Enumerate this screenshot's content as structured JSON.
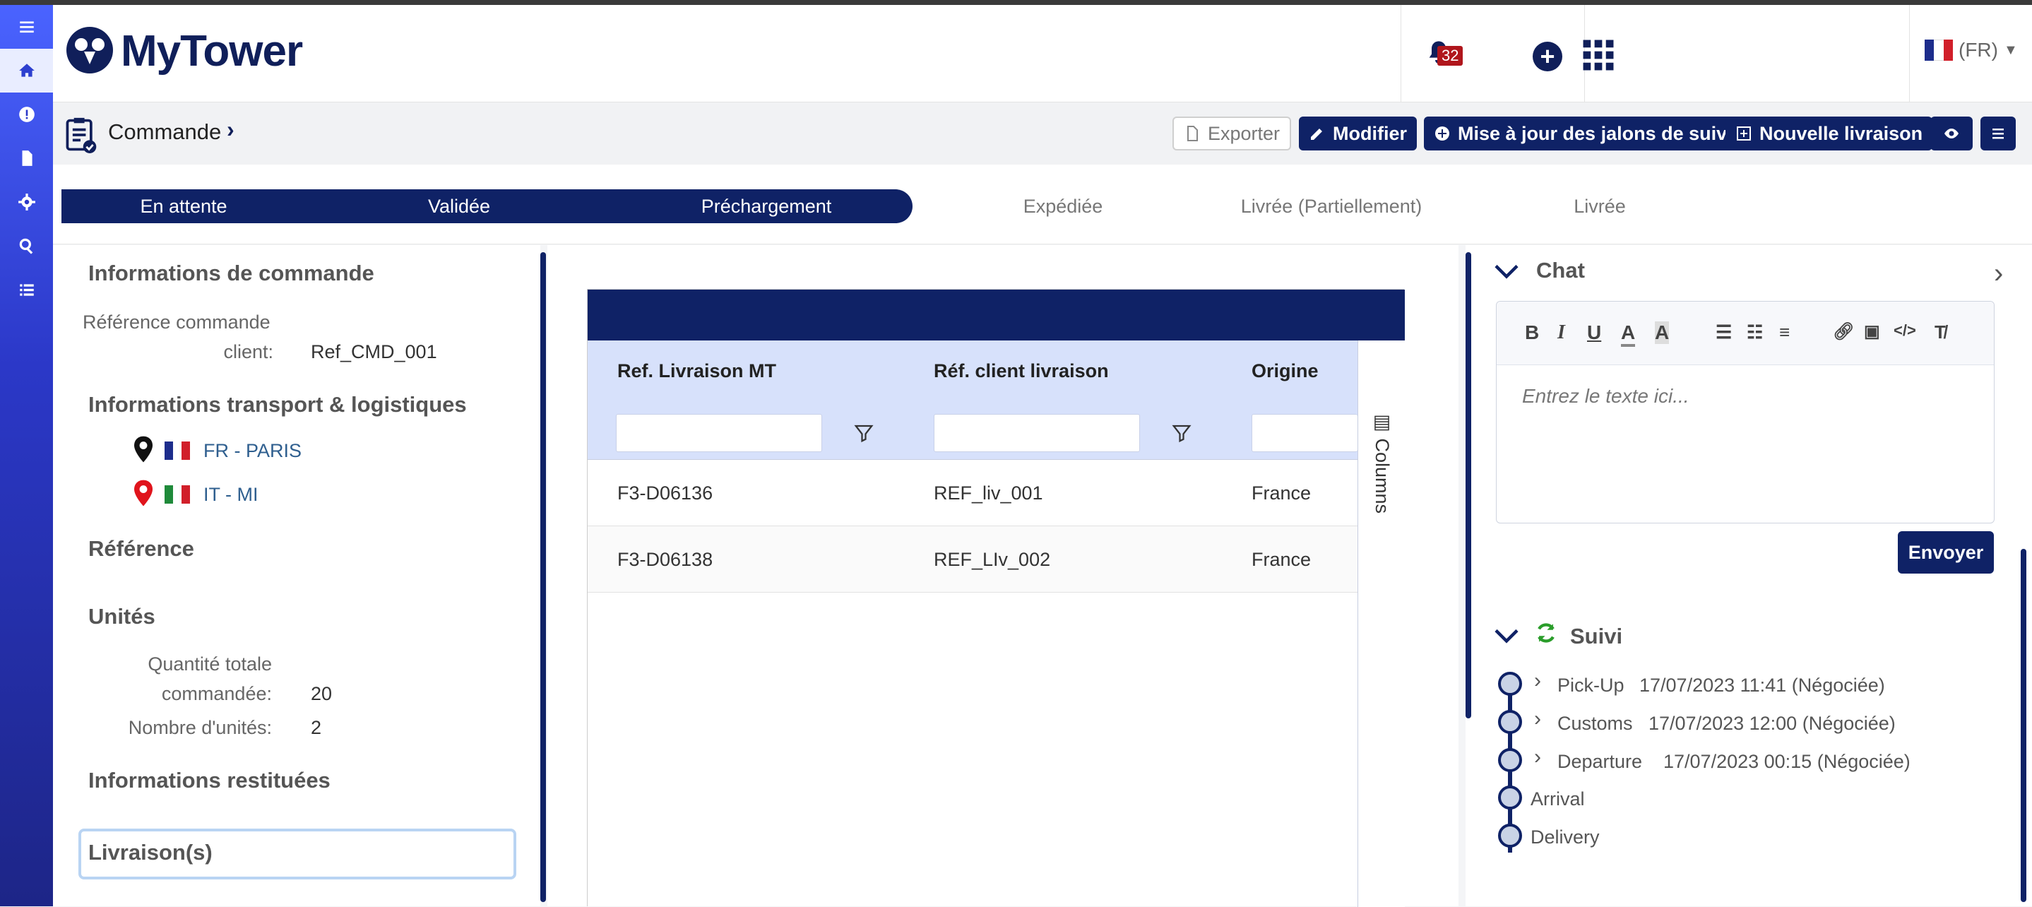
{
  "app": {
    "name": "MyTower",
    "language": "(FR)",
    "notification_count": "32"
  },
  "rail": {
    "items": [
      "menu-icon",
      "home-icon",
      "alert-icon",
      "document-icon",
      "gear-icon",
      "search-icon",
      "list-icon"
    ]
  },
  "toolbar": {
    "breadcrumb": "Commande",
    "export_label": "Exporter",
    "edit_label": "Modifier",
    "milestones_label": "Mise à jour des jalons de suivi",
    "new_delivery_label": "Nouvelle livraison"
  },
  "steps": [
    {
      "label": "En attente",
      "done": true
    },
    {
      "label": "Validée",
      "done": true
    },
    {
      "label": "Préchargement",
      "done": true
    },
    {
      "label": "Expédiée",
      "done": false
    },
    {
      "label": "Livrée (Partiellement)",
      "done": false
    },
    {
      "label": "Livrée",
      "done": false
    }
  ],
  "left": {
    "order_info_title": "Informations de commande",
    "client_ref_label_1": "Référence commande",
    "client_ref_label_2": "client:",
    "client_ref_value": "Ref_CMD_001",
    "transport_title": "Informations transport & logistiques",
    "origin": "FR - PARIS",
    "destination": "IT - MI",
    "reference_title": "Référence",
    "units_title": "Unités",
    "total_qty_label_1": "Quantité totale",
    "total_qty_label_2": "commandée:",
    "total_qty_value": "20",
    "units_count_label": "Nombre d'unités:",
    "units_count_value": "2",
    "returned_title": "Informations restituées",
    "deliveries_title": "Livraison(s)"
  },
  "grid": {
    "columns": [
      "Ref. Livraison MT",
      "Réf. client livraison",
      "Origine"
    ],
    "rows": [
      [
        "F3-D06136",
        "REF_liv_001",
        "France"
      ],
      [
        "F3-D06138",
        "REF_LIv_002",
        "France"
      ]
    ],
    "columns_panel_label": "Columns"
  },
  "chat": {
    "title": "Chat",
    "placeholder": "Entrez le texte ici...",
    "send_label": "Envoyer"
  },
  "tracking": {
    "title": "Suivi",
    "events": [
      {
        "name": "Pick-Up",
        "time": "17/07/2023 11:41 (Négociée)"
      },
      {
        "name": "Customs",
        "time": "17/07/2023 12:00 (Négociée)"
      },
      {
        "name": "Departure",
        "time": "17/07/2023 00:15 (Négociée)"
      },
      {
        "name": "Arrival",
        "time": ""
      },
      {
        "name": "Delivery",
        "time": ""
      }
    ]
  },
  "colors": {
    "brand": "#0f2266",
    "rail_top": "#4a63ff",
    "grid_header": "#d7e1fb"
  }
}
